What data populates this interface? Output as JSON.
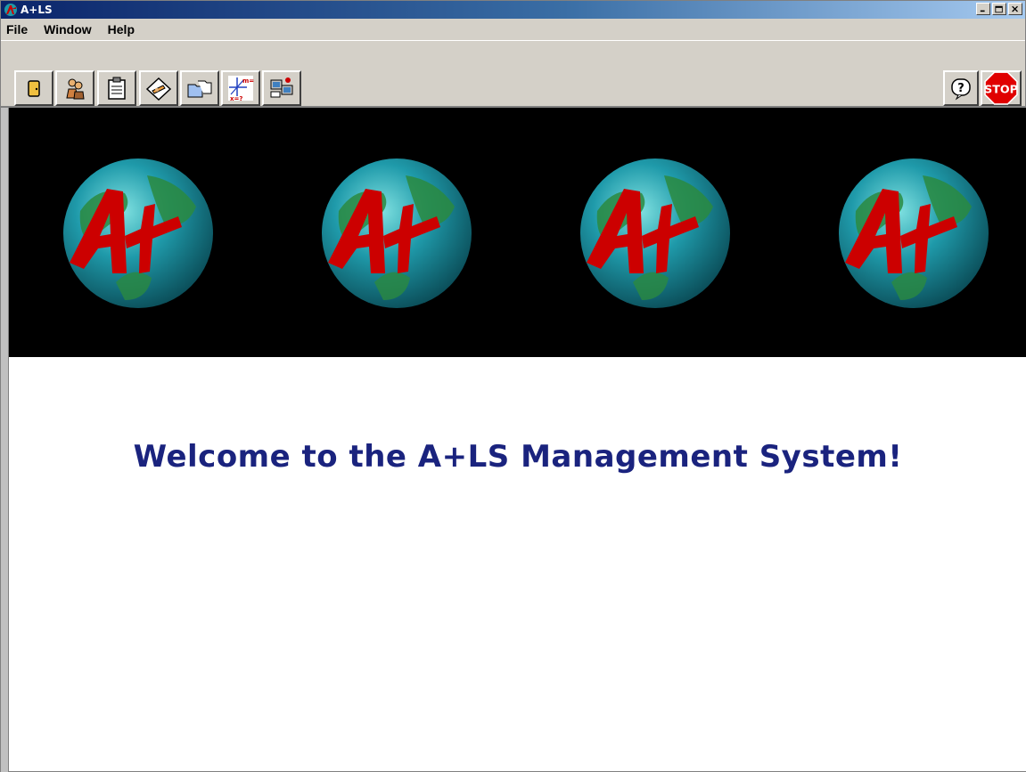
{
  "window": {
    "title": "A+LS"
  },
  "menu": {
    "items": [
      "File",
      "Window",
      "Help"
    ]
  },
  "toolbar": {
    "left_buttons": [
      {
        "icon": "door-icon"
      },
      {
        "icon": "people-icon"
      },
      {
        "icon": "clipboard-icon"
      },
      {
        "icon": "grading-pencil-icon"
      },
      {
        "icon": "folders-icon"
      },
      {
        "icon": "math-graph-icon",
        "text": "m=1 x=?"
      },
      {
        "icon": "computer-lab-icon"
      }
    ],
    "right_buttons": [
      {
        "icon": "help-icon",
        "text": "?"
      },
      {
        "icon": "stop-icon",
        "text": "STOP"
      }
    ]
  },
  "banner": {
    "globe_count": 4,
    "logo_text": "A+",
    "colors": {
      "background": "#000000",
      "globe": "#1e9aa8",
      "logo": "#cc0000"
    }
  },
  "main": {
    "welcome": "Welcome to the A+LS Management System!",
    "welcome_color": "#1a237e"
  }
}
